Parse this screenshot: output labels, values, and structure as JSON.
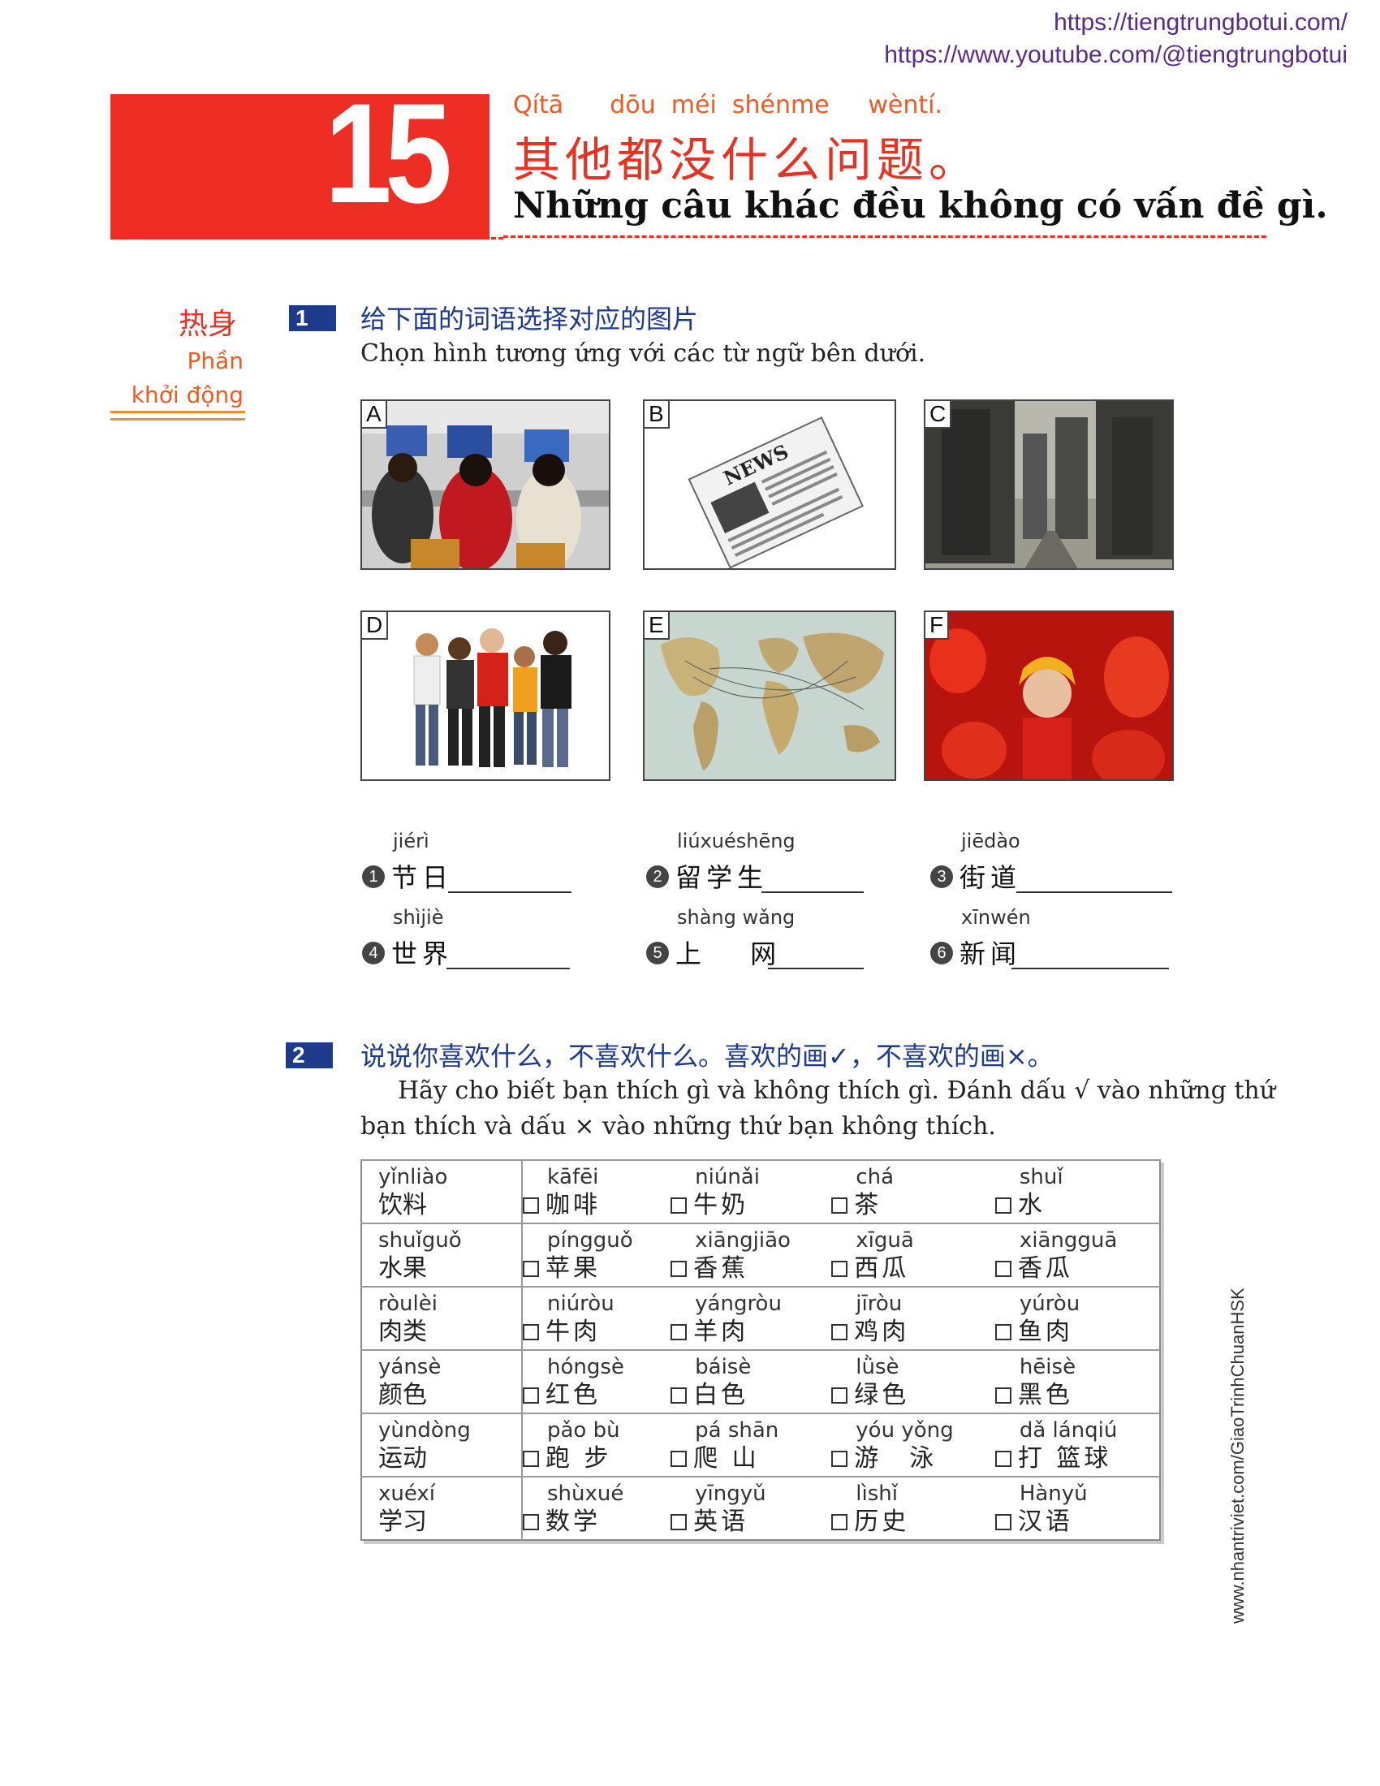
{
  "urls": [
    "https://tiengtrungbotui.com/",
    "https://www.youtube.com/@tiengtrungbotui"
  ],
  "lesson": {
    "number": "15",
    "pinyin": "Qítā      dōu  méi  shénme     wèntí.",
    "title_zh": "其他都没什么问题。",
    "title_vi": "Những câu khác đều không có vấn đề gì."
  },
  "warmup": {
    "zh": "热身",
    "vi_line1": "Phần",
    "vi_line2": "khởi động"
  },
  "section1": {
    "num": "1",
    "instruction_zh": "给下面的词语选择对应的图片",
    "instruction_vi": "Chọn hình tương ứng với các từ ngữ bên dưới.",
    "pictures": [
      {
        "letter": "A",
        "subject": "people-at-computers"
      },
      {
        "letter": "B",
        "subject": "newspaper",
        "caption": "NEWS"
      },
      {
        "letter": "C",
        "subject": "city-street"
      },
      {
        "letter": "D",
        "subject": "students-group"
      },
      {
        "letter": "E",
        "subject": "world-map"
      },
      {
        "letter": "F",
        "subject": "festival-lanterns"
      }
    ],
    "vocab": [
      {
        "n": "1",
        "pinyin": "jiérì",
        "zh": "节日"
      },
      {
        "n": "2",
        "pinyin": "liúxuéshēng",
        "zh": "留学生"
      },
      {
        "n": "3",
        "pinyin": "jiēdào",
        "zh": "街道"
      },
      {
        "n": "4",
        "pinyin": "shìjiè",
        "zh": "世界"
      },
      {
        "n": "5",
        "pinyin": "shàng wǎng",
        "zh": "上　 网"
      },
      {
        "n": "6",
        "pinyin": "xīnwén",
        "zh": "新闻"
      }
    ]
  },
  "section2": {
    "num": "2",
    "instruction_zh": "说说你喜欢什么，不喜欢什么。喜欢的画✓，不喜欢的画×。",
    "instruction_vi_line1": "Hãy cho biết bạn thích gì và không thích gì. Đánh dấu √ vào những thứ",
    "instruction_vi_line2": "bạn thích và dấu × vào những thứ bạn không thích.",
    "rows": [
      {
        "cat_py": "yǐnliào",
        "cat_zh": "饮料",
        "items": [
          {
            "py": "kāfēi",
            "zh": "咖啡"
          },
          {
            "py": "niúnǎi",
            "zh": "牛奶"
          },
          {
            "py": "chá",
            "zh": "茶"
          },
          {
            "py": "shuǐ",
            "zh": "水"
          }
        ]
      },
      {
        "cat_py": "shuǐguǒ",
        "cat_zh": "水果",
        "items": [
          {
            "py": "píngguǒ",
            "zh": "苹果"
          },
          {
            "py": "xiāngjiāo",
            "zh": "香蕉"
          },
          {
            "py": "xīguā",
            "zh": "西瓜"
          },
          {
            "py": "xiāngguā",
            "zh": "香瓜"
          }
        ]
      },
      {
        "cat_py": "ròulèi",
        "cat_zh": "肉类",
        "items": [
          {
            "py": "niúròu",
            "zh": "牛肉"
          },
          {
            "py": "yángròu",
            "zh": "羊肉"
          },
          {
            "py": "jīròu",
            "zh": "鸡肉"
          },
          {
            "py": "yúròu",
            "zh": "鱼肉"
          }
        ]
      },
      {
        "cat_py": "yánsè",
        "cat_zh": "颜色",
        "items": [
          {
            "py": "hóngsè",
            "zh": "红色"
          },
          {
            "py": "báisè",
            "zh": "白色"
          },
          {
            "py": "lǜsè",
            "zh": "绿色"
          },
          {
            "py": "hēisè",
            "zh": "黑色"
          }
        ]
      },
      {
        "cat_py": "yùndòng",
        "cat_zh": "运动",
        "items": [
          {
            "py": "pǎo bù",
            "zh": "跑 步"
          },
          {
            "py": "pá shān",
            "zh": "爬 山"
          },
          {
            "py": "yóu yǒng",
            "zh": "游　泳"
          },
          {
            "py": "dǎ lánqiú",
            "zh": "打 篮球"
          }
        ]
      },
      {
        "cat_py": "xuéxí",
        "cat_zh": "学习",
        "items": [
          {
            "py": "shùxué",
            "zh": "数学"
          },
          {
            "py": "yīngyǔ",
            "zh": "英语"
          },
          {
            "py": "lìshǐ",
            "zh": "历史"
          },
          {
            "py": "Hànyǔ",
            "zh": "汉语"
          }
        ]
      }
    ]
  },
  "side_url": "www.nhantriviet.com/GiaoTrinhChuanHSK"
}
